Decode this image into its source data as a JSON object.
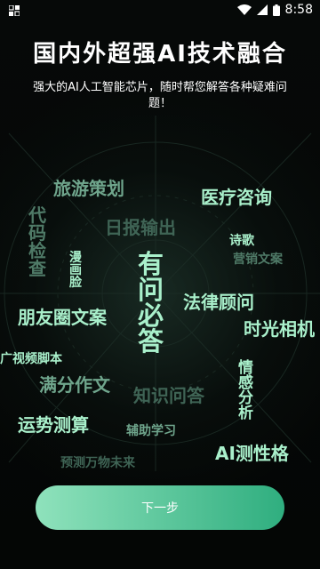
{
  "status_bar": {
    "time": "8:58"
  },
  "header": {
    "headline": "国内外超强AI技术融合",
    "subtitle": "强大的AI人工智能芯片，随时帮您解答各种疑难问题！"
  },
  "words": {
    "travel": "旅游策划",
    "medical": "医疗咨询",
    "code_check": "代码检查",
    "daily_report": "日报输出",
    "poetry": "诗歌",
    "marketing": "营销文案",
    "comic_face": "漫画脸",
    "center": "有问必答",
    "legal": "法律顾问",
    "moments": "朋友圈文案",
    "time_album": "时光相机",
    "ad_video": "广视频脚本",
    "full_score": "满分作文",
    "knowledge": "知识问答",
    "feeling": "情感分析",
    "fortune": "运势测算",
    "study": "辅助学习",
    "ai_personality": "AI测性格",
    "predict": "预测万物未来"
  },
  "actions": {
    "next_label": "下一步"
  },
  "colors": {
    "bright_green": "#a9f0cb",
    "mid_green": "#6fa58c",
    "dim_green": "#3f6455",
    "button_start": "#8fe2bc",
    "button_end": "#2fae7f"
  }
}
